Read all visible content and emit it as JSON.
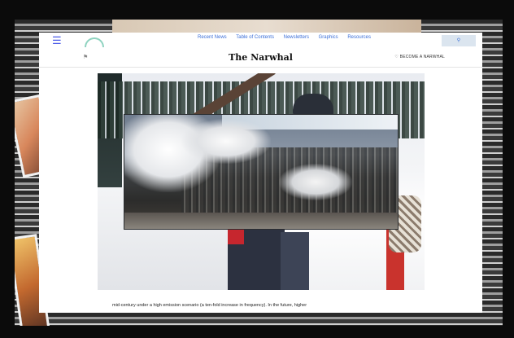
{
  "nav": {
    "menu_icon": "hamburger-menu-icon",
    "logo_icon": "narwhal-logo-icon",
    "links": [
      "Recent News",
      "Table of Contents",
      "Newsletters",
      "Graphics",
      "Resources"
    ],
    "search_icon": "search-icon"
  },
  "header": {
    "flag_icon": "flag-icon",
    "title": "The Narwhal",
    "member_icon": "heart-icon",
    "member_label": "BECOME A NARWHAL"
  },
  "hero": {
    "caption": "",
    "background_icon": "winter-forest-photo",
    "inset_icon": "industrial-plant-smoke-photo"
  },
  "article": {
    "visible_line": "mid-century under a high emission scenario (a ten-fold increase in frequency). In the future, higher"
  },
  "colors": {
    "nav_link": "#3b6fd8",
    "menu": "#4a5ae8",
    "logo": "#8fd3c0"
  }
}
